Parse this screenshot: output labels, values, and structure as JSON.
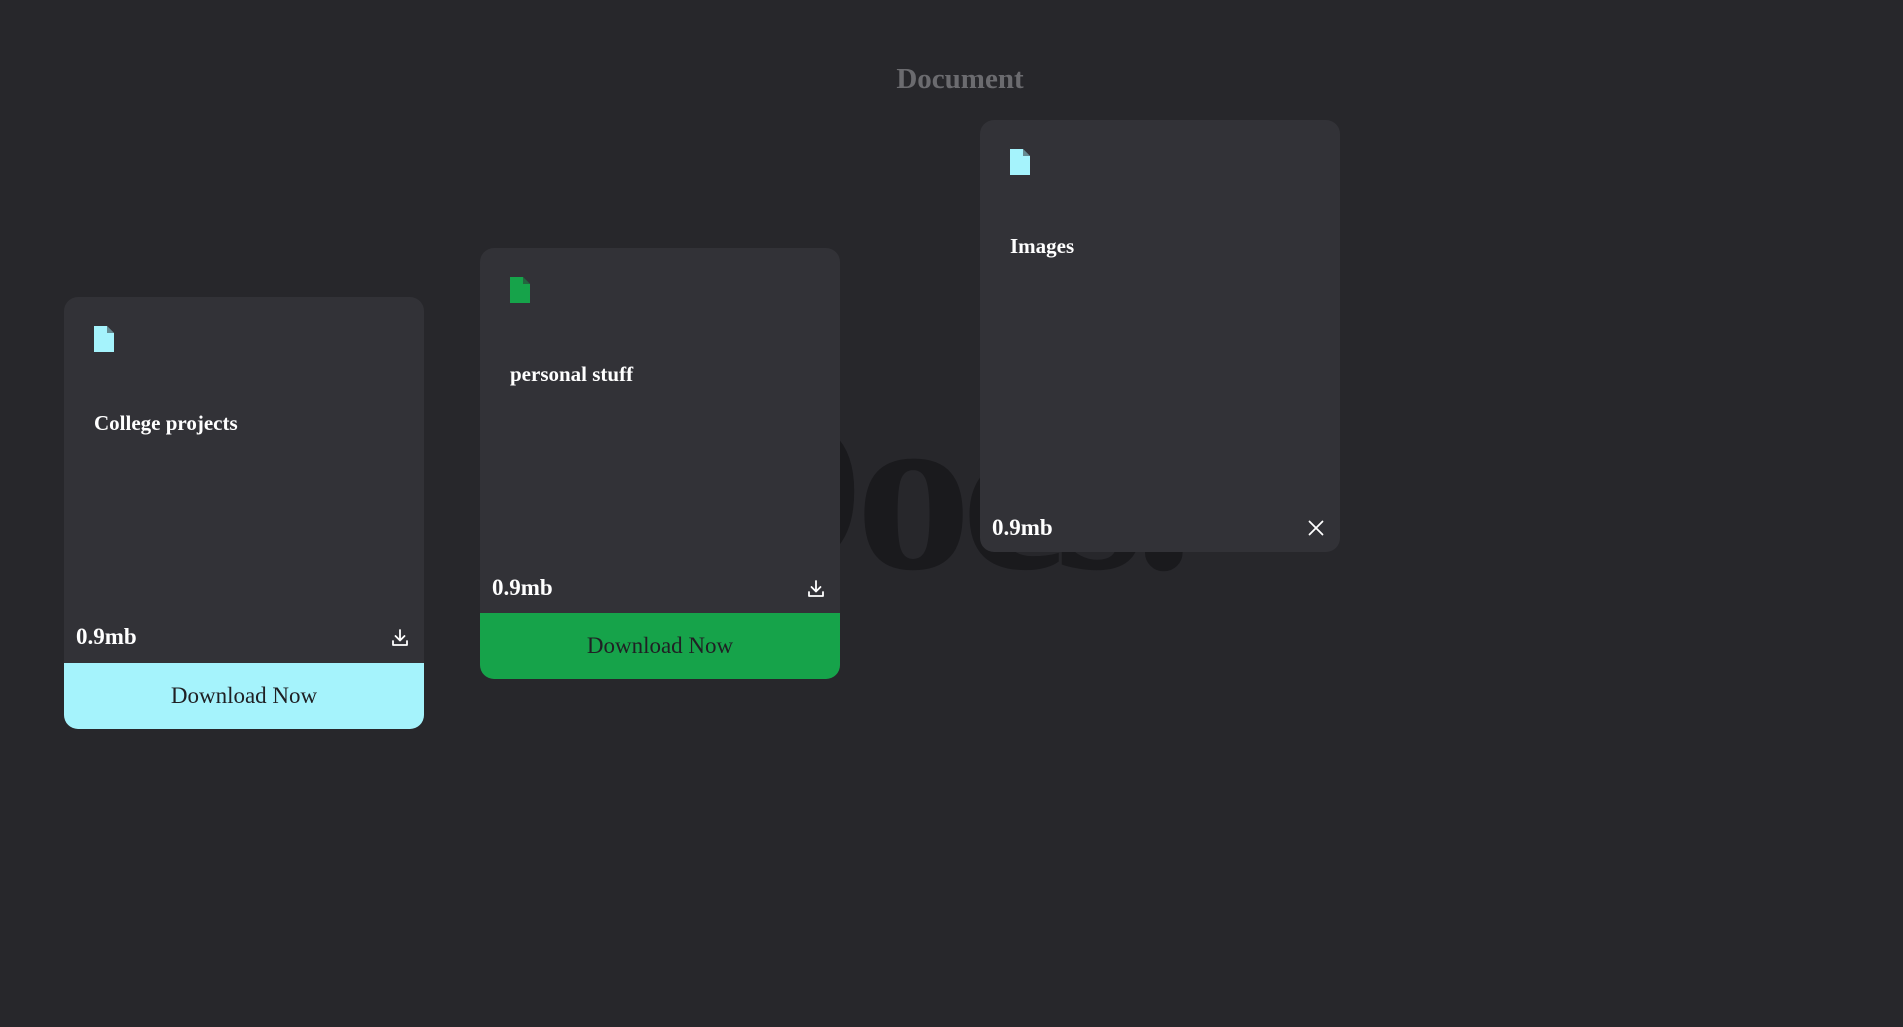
{
  "header": {
    "title": "Document"
  },
  "watermark": {
    "text": "Docs."
  },
  "colors": {
    "background": "#27272b",
    "card": "#323237",
    "cyan_accent": "#a5f3fc",
    "green_accent": "#16a34a"
  },
  "cards": [
    {
      "title": "College projects",
      "size": "0.9mb",
      "icon": "file-icon",
      "icon_color": "#a5f3fc",
      "action_icon": "download-icon",
      "button_label": "Download Now"
    },
    {
      "title": "personal stuff",
      "size": "0.9mb",
      "icon": "file-icon",
      "icon_color": "#16a34a",
      "action_icon": "download-icon",
      "button_label": "Download Now"
    },
    {
      "title": "Images",
      "size": "0.9mb",
      "icon": "file-icon",
      "icon_color": "#a5f3fc",
      "action_icon": "close-icon"
    }
  ]
}
